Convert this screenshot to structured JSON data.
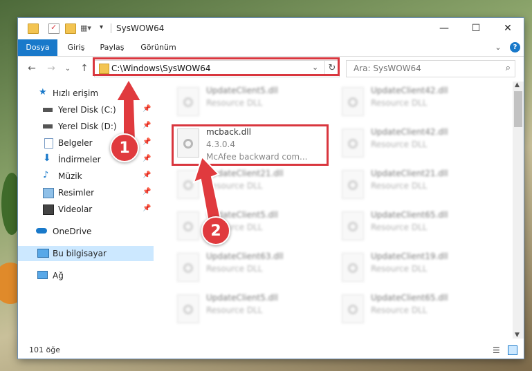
{
  "window": {
    "title": "SysWOW64"
  },
  "ribbon": {
    "tabs": [
      "Dosya",
      "Giriş",
      "Paylaş",
      "Görünüm"
    ]
  },
  "address": {
    "path": "C:\\Windows\\SysWOW64"
  },
  "search": {
    "placeholder": "Ara: SysWOW64"
  },
  "sidebar": {
    "items": [
      {
        "label": "Hızlı erişim",
        "icon": "star-icon"
      },
      {
        "label": "Yerel Disk (C:)",
        "icon": "drive-icon",
        "pinned": true
      },
      {
        "label": "Yerel Disk (D:)",
        "icon": "drive-icon",
        "pinned": true
      },
      {
        "label": "Belgeler",
        "icon": "documents-icon",
        "pinned": true
      },
      {
        "label": "İndirmeler",
        "icon": "download-icon",
        "pinned": true
      },
      {
        "label": "Müzik",
        "icon": "music-icon",
        "pinned": true
      },
      {
        "label": "Resimler",
        "icon": "pictures-icon",
        "pinned": true
      },
      {
        "label": "Videolar",
        "icon": "video-icon",
        "pinned": true
      },
      {
        "label": "OneDrive",
        "icon": "cloud-icon"
      },
      {
        "label": "Bu bilgisayar",
        "icon": "computer-icon",
        "selected": true
      },
      {
        "label": "Ağ",
        "icon": "network-icon"
      }
    ]
  },
  "files": {
    "left": [
      {
        "name": "UpdateClient5.dll",
        "desc": "Resource DLL"
      },
      {
        "name": "mcback.dll",
        "version": "4.3.0.4",
        "desc": "McAfee backward com..."
      },
      {
        "name": "UpdateClient21.dll",
        "desc": "Resource DLL"
      },
      {
        "name": "UpdateClient5.dll",
        "desc": "Resource DLL"
      },
      {
        "name": "UpdateClient63.dll",
        "desc": "Resource DLL"
      },
      {
        "name": "UpdateClient5.dll",
        "desc": "Resource DLL"
      }
    ],
    "right": [
      {
        "name": "UpdateClient42.dll",
        "desc": "Resource DLL"
      },
      {
        "name": "UpdateClient42.dll",
        "desc": "Resource DLL"
      },
      {
        "name": "UpdateClient21.dll",
        "desc": "Resource DLL"
      },
      {
        "name": "UpdateClient65.dll",
        "desc": "Resource DLL"
      },
      {
        "name": "UpdateClient19.dll",
        "desc": "Resource DLL"
      },
      {
        "name": "UpdateClient65.dll",
        "desc": "Resource DLL"
      }
    ]
  },
  "status": {
    "count": "101 öğe"
  },
  "annotations": {
    "badge1": "1",
    "badge2": "2"
  },
  "colors": {
    "accent": "#1979ca",
    "highlight": "#d9363e"
  }
}
